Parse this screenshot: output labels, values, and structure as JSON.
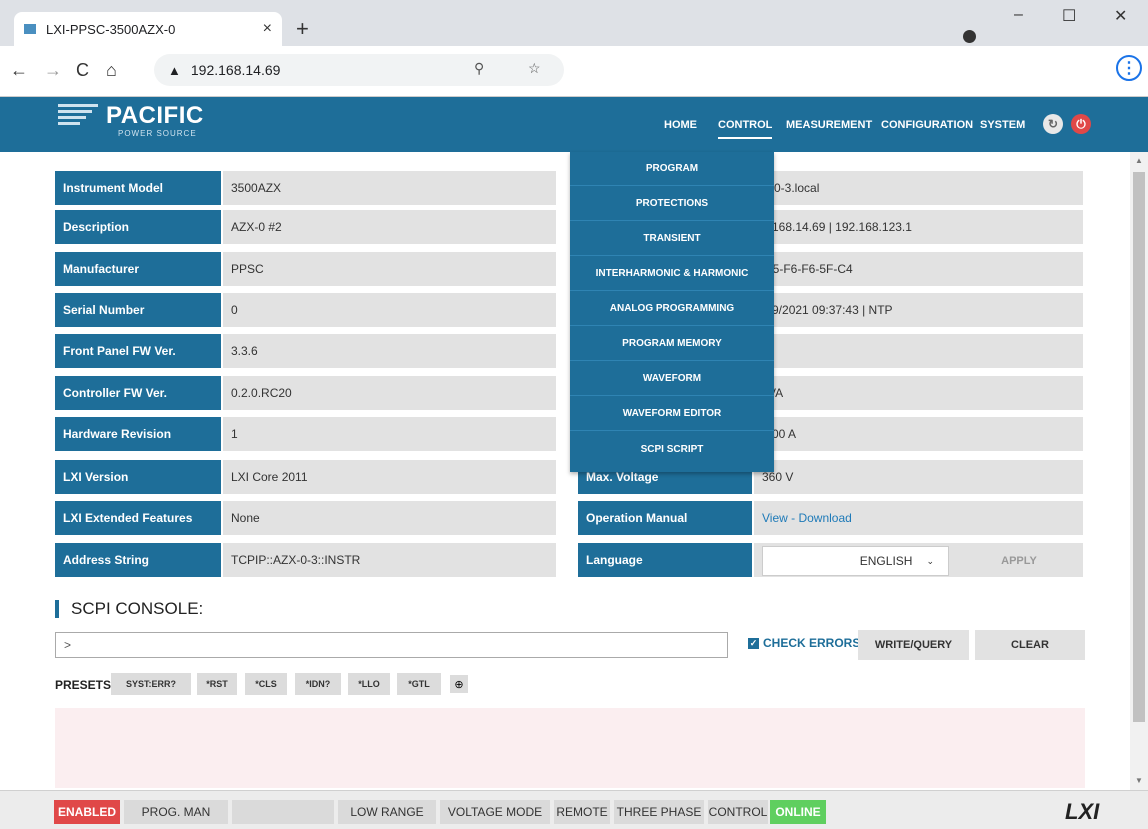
{
  "browser": {
    "tab_title": "LXI-PPSC-3500AZX-0",
    "url": "192.168.14.69"
  },
  "header": {
    "brand": "PACIFIC",
    "brand_sub": "POWER SOURCE",
    "nav": [
      "HOME",
      "CONTROL",
      "MEASUREMENT",
      "CONFIGURATION",
      "SYSTEM"
    ],
    "active_nav": "CONTROL"
  },
  "control_menu": [
    "PROGRAM",
    "PROTECTIONS",
    "TRANSIENT",
    "INTERHARMONIC & HARMONIC",
    "ANALOG PROGRAMMING",
    "PROGRAM MEMORY",
    "WAVEFORM",
    "WAVEFORM EDITOR",
    "SCPI SCRIPT"
  ],
  "info_left": [
    {
      "label": "Instrument Model",
      "value": "3500AZX"
    },
    {
      "label": "Description",
      "value": "AZX-0 #2"
    },
    {
      "label": "Manufacturer",
      "value": "PPSC"
    },
    {
      "label": "Serial Number",
      "value": "0"
    },
    {
      "label": "Front Panel FW Ver.",
      "value": "3.3.6"
    },
    {
      "label": "Controller FW Ver.",
      "value": "0.2.0.RC20"
    },
    {
      "label": "Hardware Revision",
      "value": "1"
    },
    {
      "label": "LXI Version",
      "value": "LXI Core 2011"
    },
    {
      "label": "LXI Extended Features",
      "value": "None"
    },
    {
      "label": "Address String",
      "value": "TCPIP::AZX-0-3::INSTR"
    }
  ],
  "info_right": [
    {
      "label": "",
      "value": "X-0-3.local"
    },
    {
      "label": "",
      "value": "2.168.14.69 | 192.168.123.1"
    },
    {
      "label": "",
      "value": "-15-F6-F6-5F-C4"
    },
    {
      "label": "",
      "value": "/09/2021 09:37:43 | NTP"
    },
    {
      "label": "",
      "value": ""
    },
    {
      "label": "",
      "value": "kVA"
    },
    {
      "label": "",
      "value": "0.00 A"
    },
    {
      "label": "Max. Voltage",
      "value": "360 V"
    },
    {
      "label": "Operation Manual",
      "value": "View - Download"
    },
    {
      "label": "Language",
      "value": ""
    }
  ],
  "language": {
    "selected": "ENGLISH",
    "apply_label": "APPLY"
  },
  "console": {
    "title": "SCPI CONSOLE:",
    "prompt": ">",
    "check_errors_label": "CHECK ERRORS",
    "write_query_label": "WRITE/QUERY",
    "clear_label": "CLEAR",
    "presets_label": "PRESETS",
    "presets": [
      "SYST:ERR?",
      "*RST",
      "*CLS",
      "*IDN?",
      "*LLO",
      "*GTL"
    ]
  },
  "status": {
    "items": [
      "ENABLED",
      "PROG. MAN",
      "",
      "LOW RANGE",
      "VOLTAGE MODE",
      "REMOTE",
      "THREE PHASE",
      "CONTROL",
      "ONLINE"
    ],
    "logo": "LXI"
  },
  "colors": {
    "primary": "#1e6e99",
    "enabled": "#e04848",
    "online": "#5fcf5f"
  }
}
